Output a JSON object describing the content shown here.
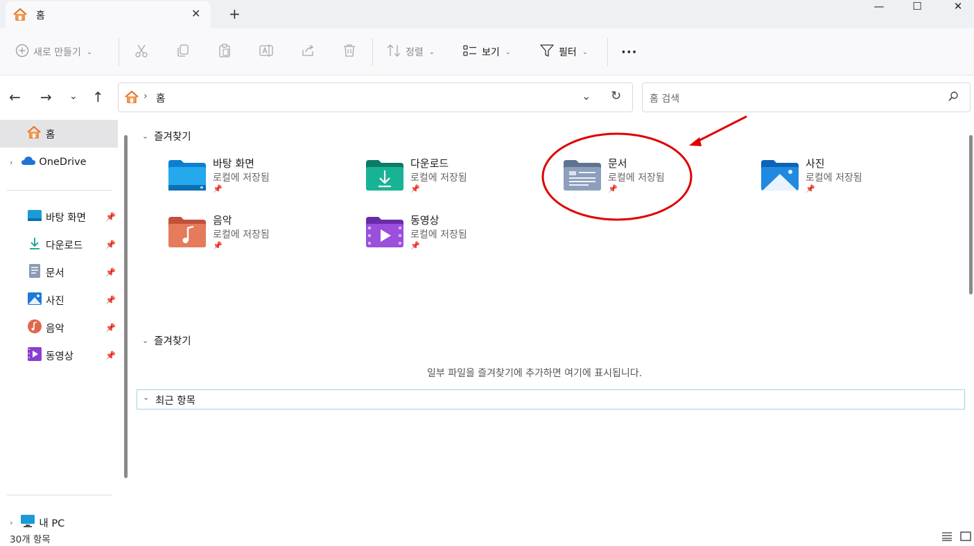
{
  "tab": {
    "title": "홈",
    "close": "✕",
    "new": "+"
  },
  "window": {
    "minimize": "—",
    "maximize": "☐",
    "close": "✕"
  },
  "toolbar": {
    "new_label": "새로 만들기",
    "sort_label": "정렬",
    "view_label": "보기",
    "filter_label": "필터",
    "more_label": "···"
  },
  "address": {
    "breadcrumb": "홈",
    "separator": "›"
  },
  "search": {
    "placeholder": "홈 검색"
  },
  "sidebar": {
    "home": "홈",
    "onedrive": "OneDrive",
    "pinned": [
      "바탕 화면",
      "다운로드",
      "문서",
      "사진",
      "음악",
      "동영상"
    ],
    "this_pc": "내 PC"
  },
  "main": {
    "favorites_header": "즐겨찾기",
    "tiles": [
      {
        "name": "바탕 화면",
        "sub": "로컬에 저장됨"
      },
      {
        "name": "다운로드",
        "sub": "로컬에 저장됨"
      },
      {
        "name": "문서",
        "sub": "로컬에 저장됨"
      },
      {
        "name": "사진",
        "sub": "로컬에 저장됨"
      },
      {
        "name": "음악",
        "sub": "로컬에 저장됨"
      },
      {
        "name": "동영상",
        "sub": "로컬에 저장됨"
      }
    ],
    "favorites_header2": "즐겨찾기",
    "favorites_empty": "일부 파일을 즐겨찾기에 추가하면 여기에 표시됩니다.",
    "recent_header": "최근 항목"
  },
  "status": {
    "count": "30개 항목"
  },
  "annotation": {
    "color": "#e00000"
  }
}
